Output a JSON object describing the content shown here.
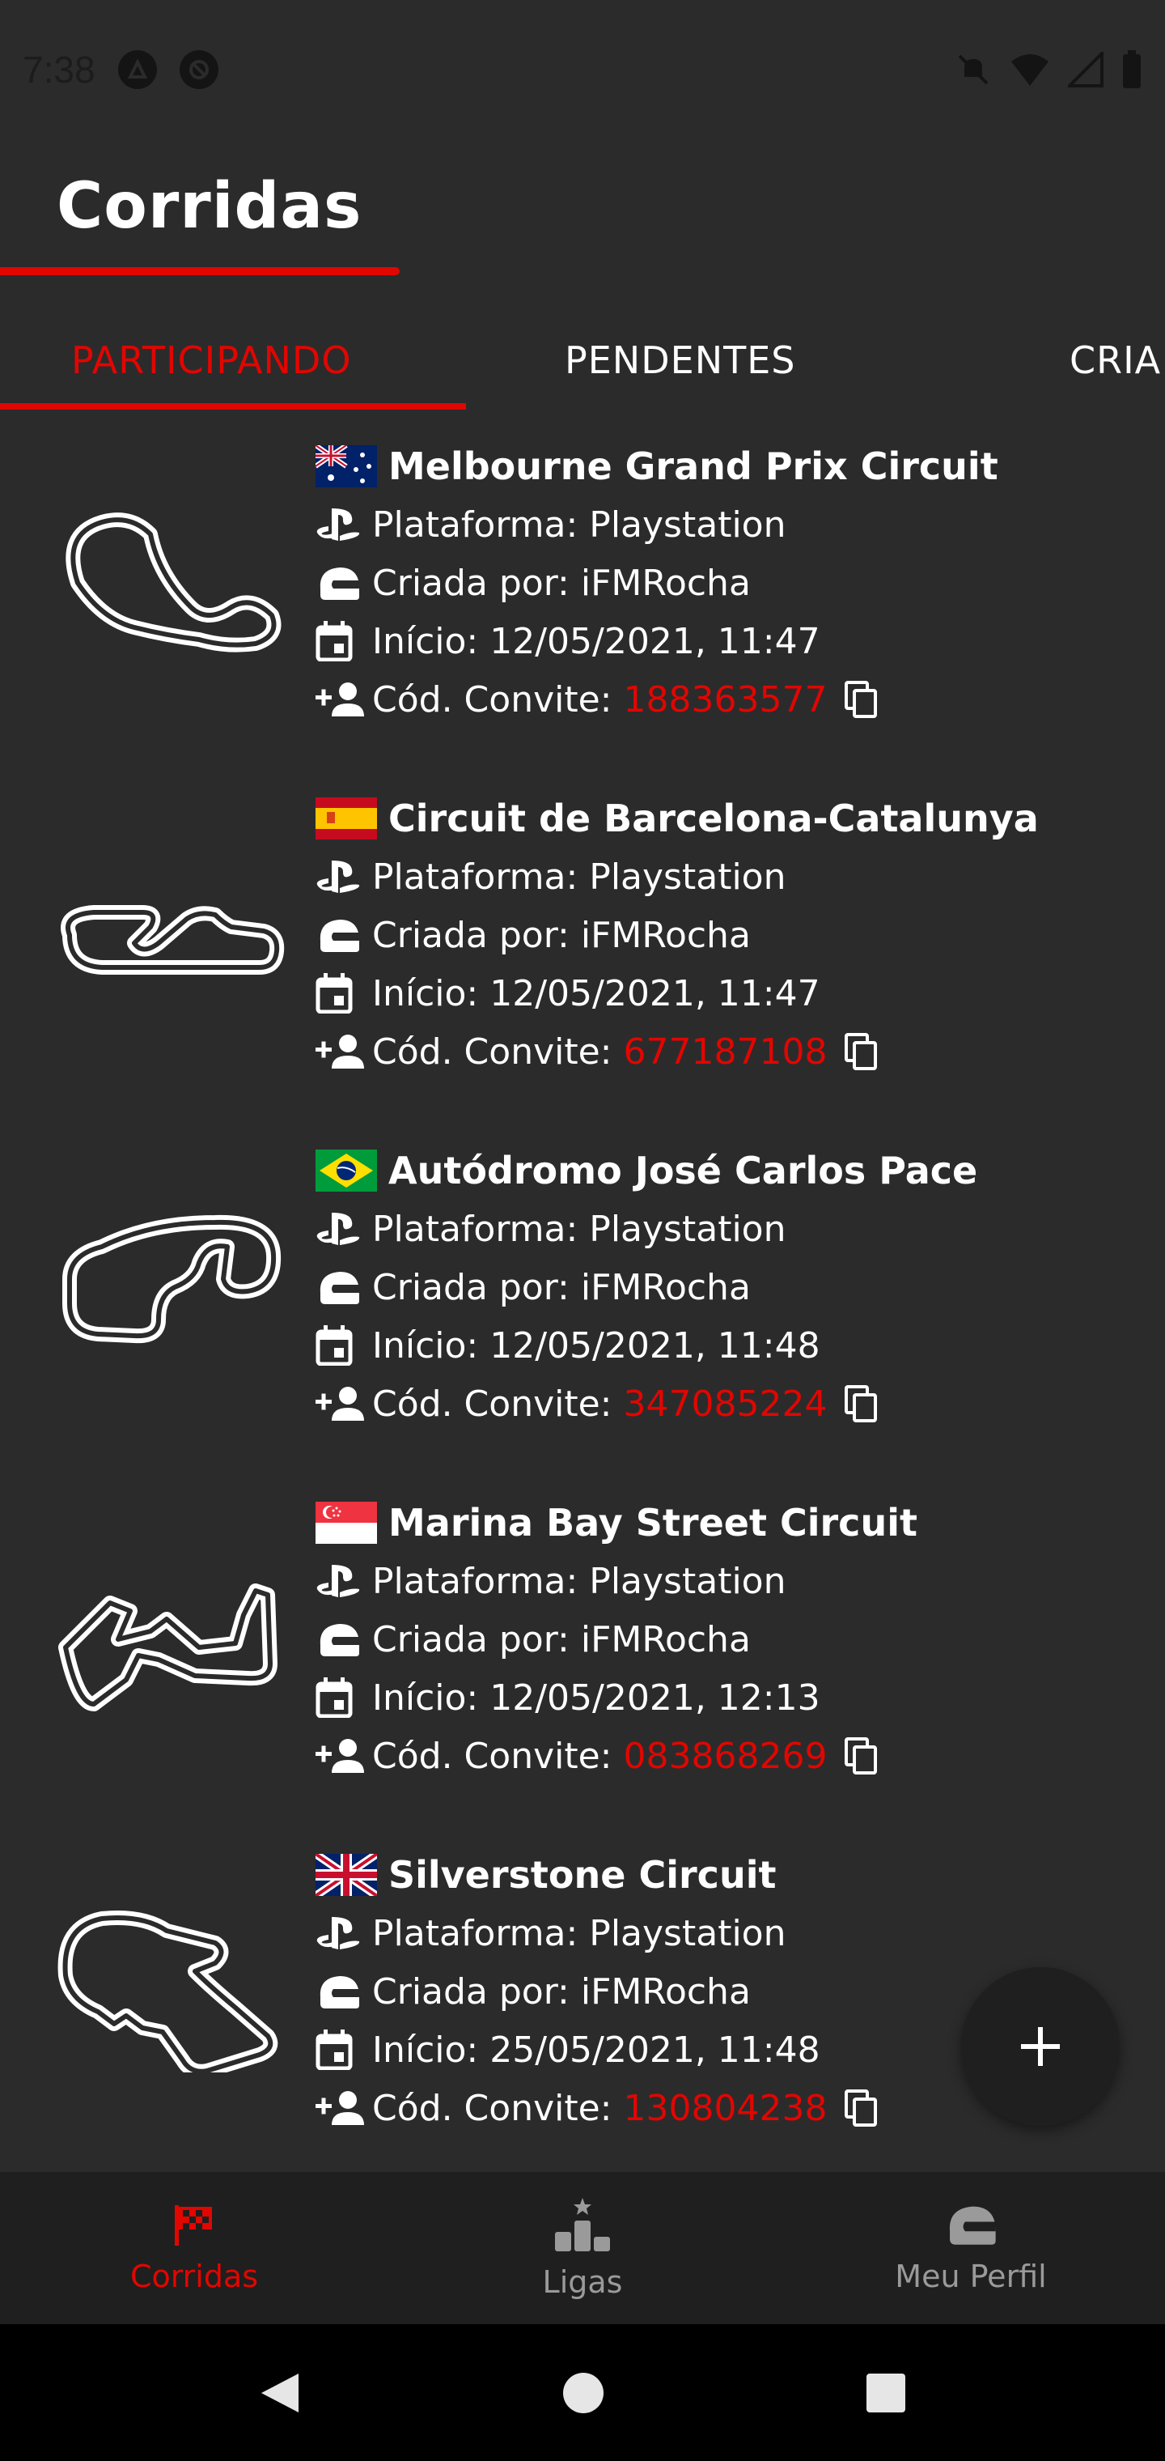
{
  "status_bar": {
    "time": "7:38"
  },
  "header": {
    "title": "Corridas"
  },
  "tabs": [
    {
      "label": "PARTICIPANDO",
      "active": true
    },
    {
      "label": "PENDENTES",
      "active": false
    },
    {
      "label": "CRIA",
      "active": false
    }
  ],
  "races": [
    {
      "name": "Melbourne Grand Prix Circuit",
      "flag": "australia",
      "platform": "Plataforma: Playstation",
      "creator": "Criada por: iFMRocha",
      "start": "Início: 12/05/2021, 11:47",
      "invite_label": "Cód. Convite:",
      "invite_code": "188363577"
    },
    {
      "name": "Circuit de Barcelona-Catalunya",
      "flag": "spain",
      "platform": "Plataforma: Playstation",
      "creator": "Criada por: iFMRocha",
      "start": "Início: 12/05/2021, 11:47",
      "invite_label": "Cód. Convite:",
      "invite_code": "677187108"
    },
    {
      "name": "Autódromo José Carlos Pace",
      "flag": "brazil",
      "platform": "Plataforma: Playstation",
      "creator": "Criada por: iFMRocha",
      "start": "Início: 12/05/2021, 11:48",
      "invite_label": "Cód. Convite:",
      "invite_code": "347085224"
    },
    {
      "name": "Marina Bay Street Circuit",
      "flag": "singapore",
      "platform": "Plataforma: Playstation",
      "creator": "Criada por: iFMRocha",
      "start": "Início: 12/05/2021, 12:13",
      "invite_label": "Cód. Convite:",
      "invite_code": "083868269"
    },
    {
      "name": "Silverstone Circuit",
      "flag": "united-kingdom",
      "platform": "Plataforma: Playstation",
      "creator": "Criada por: iFMRocha",
      "start": "Início: 25/05/2021, 11:48",
      "invite_label": "Cód. Convite:",
      "invite_code": "130804238"
    }
  ],
  "bottom_nav": [
    {
      "label": "Corridas",
      "icon": "checkered-flag-icon",
      "active": true
    },
    {
      "label": "Ligas",
      "icon": "podium-icon",
      "active": false
    },
    {
      "label": "Meu Perfil",
      "icon": "helmet-icon",
      "active": false
    }
  ],
  "colors": {
    "accent": "#e10600",
    "background": "#2b2b2c",
    "nav_background": "#1f1f1f"
  }
}
